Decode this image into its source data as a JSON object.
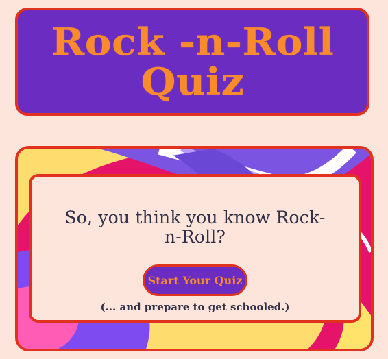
{
  "header": {
    "title_line_1": "Rock -n-Roll",
    "title_line_2": "Quiz"
  },
  "hero": {
    "headline": "So, you think you know Rock-n-Roll?",
    "start_button_label": "Start Your Quiz",
    "subtext": "(... and prepare to get schooled.)"
  },
  "colors": {
    "background": "#fde5dc",
    "panel_purple": "#6a2cc1",
    "border_red": "#e1321f",
    "accent_orange": "#f98b2c",
    "text_dark": "#2f2f46"
  }
}
